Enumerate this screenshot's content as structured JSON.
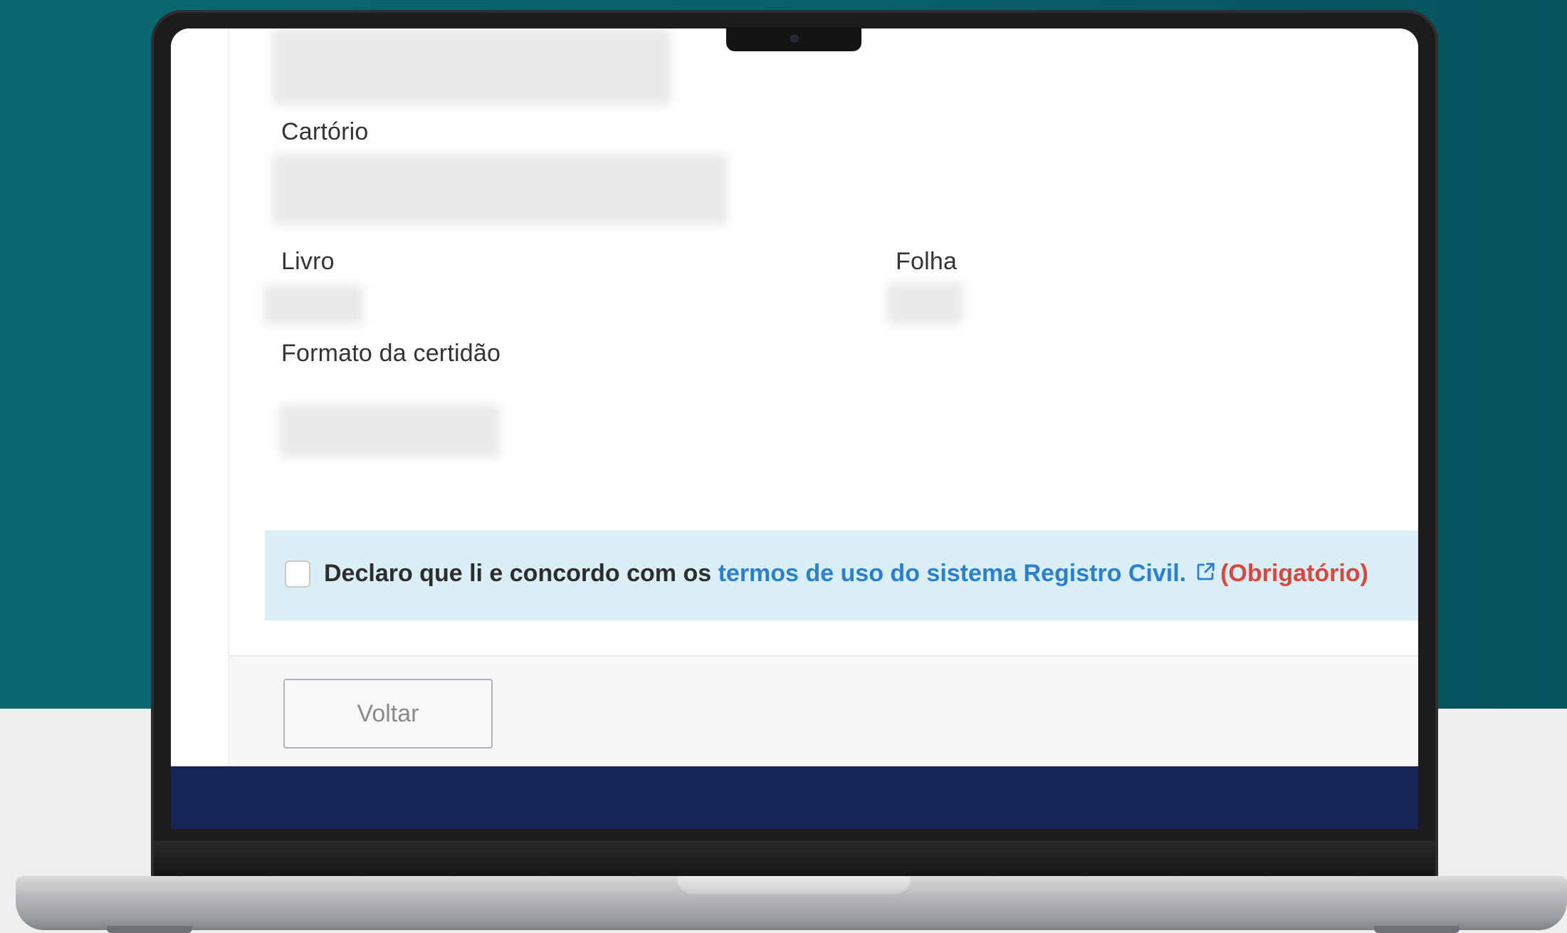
{
  "form": {
    "cartorio_label": "Cartório",
    "livro_label": "Livro",
    "folha_label": "Folha",
    "formato_label": "Formato da certidão"
  },
  "terms": {
    "prefix": "Declaro que li e concordo com os",
    "link_text": "termos de uso do sistema Registro Civil.",
    "required_text": "(Obrigatório)",
    "checked": false
  },
  "actions": {
    "back_label": "Voltar"
  },
  "colors": {
    "backdrop": "#0b6870",
    "notice_bg": "#d9eef5",
    "link": "#2b7fcf",
    "required": "#d9473f",
    "footer": "#142555"
  }
}
